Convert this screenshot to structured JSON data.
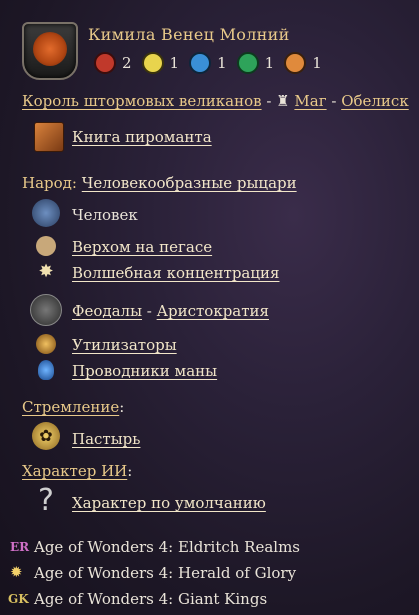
{
  "header": {
    "name": "Кимила Венец Молний",
    "affinities": [
      {
        "icon": "chaos-affinity-icon",
        "count": "2",
        "color": "#c0392b"
      },
      {
        "icon": "order-affinity-icon",
        "count": "1",
        "color": "#e8d44d"
      },
      {
        "icon": "astral-affinity-icon",
        "count": "1",
        "color": "#3a8fd6"
      },
      {
        "icon": "nature-affinity-icon",
        "count": "1",
        "color": "#2ea35a"
      },
      {
        "icon": "materium-affinity-icon",
        "count": "1",
        "color": "#e08a3c"
      }
    ]
  },
  "class_line": {
    "origin": "Король штормовых великанов",
    "sep1": " - ",
    "class": "Маг",
    "sep2": " - ",
    "tower": "Обелиск"
  },
  "tome": {
    "label": "Книга пироманта"
  },
  "people": {
    "label": "Народ",
    "colon": ":",
    "value": "Человекообразные рыцари",
    "items": [
      {
        "label": "Человек"
      },
      {
        "label": "Верхом на пегасе"
      },
      {
        "label": "Волшебная концентрация"
      },
      {
        "label_a": "Феодалы",
        "sep": " - ",
        "label_b": "Аристократия"
      },
      {
        "label": "Утилизаторы"
      },
      {
        "label": "Проводники маны"
      }
    ]
  },
  "ambition": {
    "label": "Стремление",
    "colon": ":",
    "value": "Пастырь"
  },
  "ai": {
    "label": "Характер ИИ",
    "colon": ":",
    "value": "Характер по умолчанию",
    "icon_glyph": "?"
  },
  "dlcs": [
    {
      "abbr": "ER",
      "label": "Age of Wonders 4: Eldritch Realms"
    },
    {
      "abbr": "✹",
      "label": "Age of Wonders 4: Herald of Glory"
    },
    {
      "abbr": "GK",
      "label": "Age of Wonders 4: Giant Kings"
    }
  ]
}
